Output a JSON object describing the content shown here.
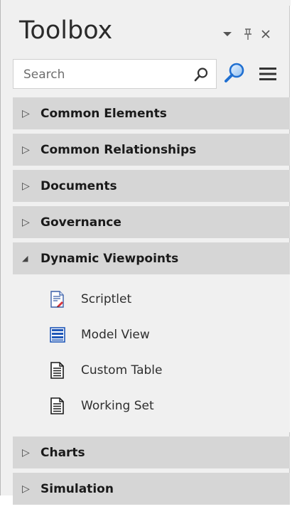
{
  "panel": {
    "title": "Toolbox",
    "dropdown_glyph": "▾",
    "pin_glyph": "ᛘ",
    "close_glyph": "×"
  },
  "search": {
    "placeholder": "Search"
  },
  "groups": [
    {
      "label": "Common Elements",
      "expanded": false
    },
    {
      "label": "Common Relationships",
      "expanded": false
    },
    {
      "label": "Documents",
      "expanded": false
    },
    {
      "label": "Governance",
      "expanded": false
    },
    {
      "label": "Dynamic Viewpoints",
      "expanded": true,
      "items": [
        {
          "label": "Scriptlet",
          "icon": "scriptlet-icon"
        },
        {
          "label": "Model View",
          "icon": "model-view-icon"
        },
        {
          "label": "Custom Table",
          "icon": "custom-table-icon"
        },
        {
          "label": "Working Set",
          "icon": "working-set-icon"
        }
      ]
    },
    {
      "label": "Charts",
      "expanded": false
    },
    {
      "label": "Simulation",
      "expanded": false
    }
  ],
  "glyphs": {
    "collapsed": "▷",
    "expanded": "◢"
  },
  "colors": {
    "group_header_bg": "#d6d6d6",
    "panel_bg": "#f0f0f0",
    "accent_blue": "#1f6fd1"
  }
}
